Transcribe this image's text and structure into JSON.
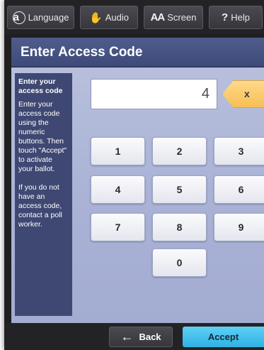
{
  "toolbar": {
    "language_label": "Language",
    "language_icon_glyph": "a",
    "audio_label": "Audio",
    "audio_icon_glyph": "✋",
    "screen_label": "Screen",
    "screen_icon_glyph": "AA",
    "help_label": "Help",
    "help_icon_glyph": "?"
  },
  "title": "Enter Access Code",
  "instructions": {
    "heading": "Enter your access code",
    "paragraph1": "Enter your access code using the numeric buttons. Then touch \"Accept\" to activate your ballot.",
    "paragraph2": "If you do not have an access code, contact a poll worker."
  },
  "code_input": {
    "value": "4"
  },
  "clear_button": "x",
  "keypad": [
    "1",
    "2",
    "3",
    "4",
    "5",
    "6",
    "7",
    "8",
    "9",
    "0"
  ],
  "footer": {
    "back_label": "Back",
    "back_icon_glyph": "←",
    "accept_label": "Accept"
  },
  "colors": {
    "title_bar": "#45518a",
    "content_bg": "#aab3d6",
    "instructions_bg": "#3f4872",
    "clear_button": "#f7bf55",
    "accept_button": "#3ec0ec",
    "toolbar_bg": "#232326"
  }
}
